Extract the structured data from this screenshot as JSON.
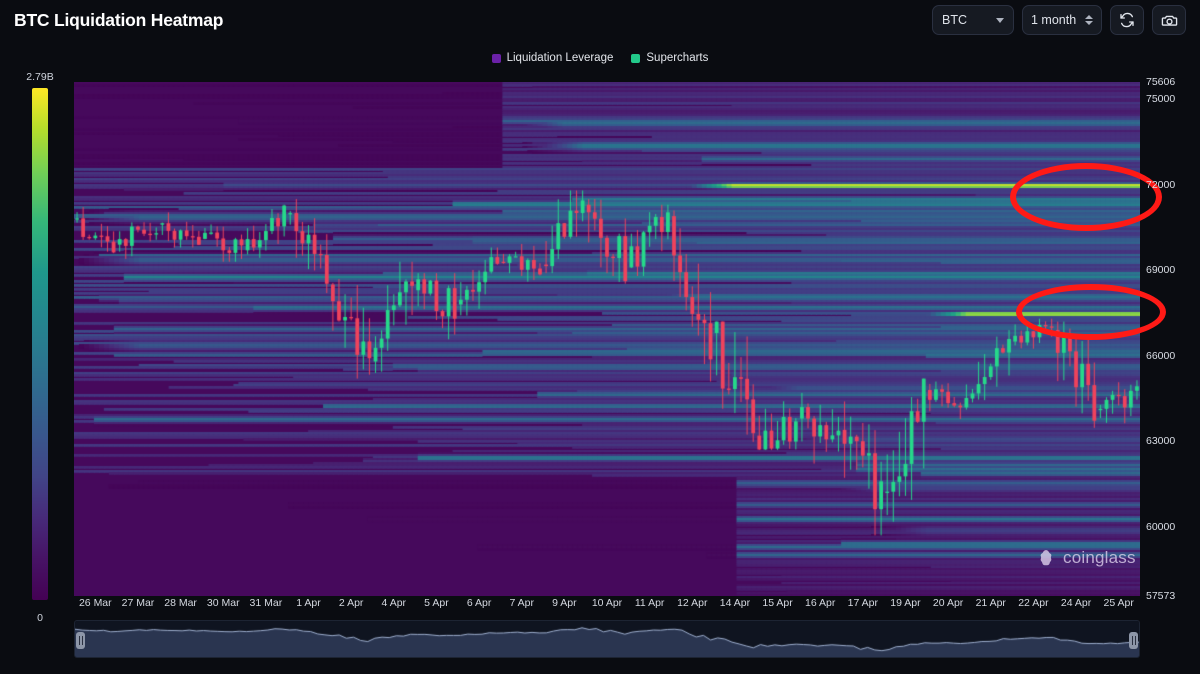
{
  "header": {
    "title": "BTC Liquidation Heatmap",
    "symbol_select": {
      "value": "BTC",
      "icon": "chevron-down-icon"
    },
    "period_stepper": {
      "value": "1 month",
      "icon": "stepper-arrows-icon"
    },
    "refresh_button": {
      "icon": "refresh-icon"
    },
    "screenshot_button": {
      "icon": "camera-icon"
    }
  },
  "legend": {
    "items": [
      {
        "label": "Liquidation Leverage",
        "color": "#6b21a8"
      },
      {
        "label": "Supercharts",
        "color": "#22c98a"
      }
    ]
  },
  "colorbar": {
    "max_label": "2.79B",
    "min_label": "0",
    "colormap": "viridis",
    "stops": [
      "#440154",
      "#414487",
      "#2a788e",
      "#22a884",
      "#7ad151",
      "#fde725"
    ]
  },
  "watermark": {
    "text": "coinglass",
    "icon": "coinglass-logo-icon"
  },
  "annotations": [
    {
      "shape": "ellipse",
      "color": "#ff1a16",
      "note": "major liquidation band near 72000"
    },
    {
      "shape": "ellipse",
      "color": "#ff1a16",
      "note": "major liquidation band near 67500"
    }
  ],
  "range_slider": {
    "left_handle": "range-handle-left",
    "right_handle": "range-handle-right"
  },
  "chart_data": {
    "type": "heatmap",
    "title": "BTC Liquidation Heatmap",
    "subtitle": "",
    "xlabel": "",
    "ylabel": "",
    "grid": false,
    "legend_position": "top-center",
    "colorbar": {
      "label": "",
      "min": 0,
      "max": 2790000000,
      "min_label": "0",
      "max_label": "2.79B"
    },
    "ylim": [
      57573,
      75606
    ],
    "y_ticks": [
      75606,
      75000,
      72000,
      69000,
      66000,
      63000,
      60000,
      57573
    ],
    "y_tick_labels": [
      "75606",
      "75000",
      "72000",
      "69000",
      "66000",
      "63000",
      "60000",
      "57573"
    ],
    "x_tick_labels": [
      "26 Mar",
      "27 Mar",
      "28 Mar",
      "30 Mar",
      "31 Mar",
      "1 Apr",
      "2 Apr",
      "4 Apr",
      "5 Apr",
      "6 Apr",
      "7 Apr",
      "9 Apr",
      "10 Apr",
      "11 Apr",
      "12 Apr",
      "14 Apr",
      "15 Apr",
      "16 Apr",
      "17 Apr",
      "19 Apr",
      "20 Apr",
      "21 Apr",
      "22 Apr",
      "24 Apr",
      "25 Apr"
    ],
    "price_series": {
      "name": "BTC price (candlesticks)",
      "up_color": "#26d98a",
      "down_color": "#f0435c",
      "candles": [
        {
          "date": "26 Mar",
          "open": 70800,
          "high": 71400,
          "low": 69600,
          "close": 69900
        },
        {
          "date": "27 Mar",
          "open": 69900,
          "high": 71200,
          "low": 69400,
          "close": 70600
        },
        {
          "date": "28 Mar",
          "open": 70600,
          "high": 71600,
          "low": 69800,
          "close": 70100
        },
        {
          "date": "30 Mar",
          "open": 70100,
          "high": 71000,
          "low": 69300,
          "close": 69700
        },
        {
          "date": "31 Mar",
          "open": 69700,
          "high": 71300,
          "low": 69200,
          "close": 71000
        },
        {
          "date": "1 Apr",
          "open": 71000,
          "high": 71500,
          "low": 68200,
          "close": 68500
        },
        {
          "date": "2 Apr",
          "open": 68500,
          "high": 69500,
          "low": 65200,
          "close": 65800
        },
        {
          "date": "4 Apr",
          "open": 65800,
          "high": 69300,
          "low": 65400,
          "close": 68300
        },
        {
          "date": "5 Apr",
          "open": 68300,
          "high": 68900,
          "low": 66200,
          "close": 67800
        },
        {
          "date": "6 Apr",
          "open": 67800,
          "high": 69800,
          "low": 67400,
          "close": 69300
        },
        {
          "date": "7 Apr",
          "open": 69300,
          "high": 70300,
          "low": 68600,
          "close": 69200
        },
        {
          "date": "9 Apr",
          "open": 69200,
          "high": 71800,
          "low": 68900,
          "close": 71300
        },
        {
          "date": "10 Apr",
          "open": 71300,
          "high": 71500,
          "low": 67400,
          "close": 69100
        },
        {
          "date": "11 Apr",
          "open": 69100,
          "high": 71300,
          "low": 68800,
          "close": 70900
        },
        {
          "date": "12 Apr",
          "open": 70900,
          "high": 71100,
          "low": 65100,
          "close": 66800
        },
        {
          "date": "14 Apr",
          "open": 66800,
          "high": 67200,
          "low": 61800,
          "close": 63200
        },
        {
          "date": "15 Apr",
          "open": 63200,
          "high": 66500,
          "low": 62700,
          "close": 63800
        },
        {
          "date": "16 Apr",
          "open": 63800,
          "high": 64800,
          "low": 61500,
          "close": 63400
        },
        {
          "date": "17 Apr",
          "open": 63400,
          "high": 64400,
          "low": 59700,
          "close": 61200
        },
        {
          "date": "19 Apr",
          "open": 61200,
          "high": 65200,
          "low": 59600,
          "close": 64800
        },
        {
          "date": "20 Apr",
          "open": 64800,
          "high": 65500,
          "low": 63700,
          "close": 64500
        },
        {
          "date": "21 Apr",
          "open": 64500,
          "high": 66900,
          "low": 64200,
          "close": 66500
        },
        {
          "date": "22 Apr",
          "open": 66500,
          "high": 67300,
          "low": 65800,
          "close": 66900
        },
        {
          "date": "24 Apr",
          "open": 66900,
          "high": 67200,
          "low": 63200,
          "close": 64100
        },
        {
          "date": "25 Apr",
          "open": 64100,
          "high": 65400,
          "low": 63500,
          "close": 64700
        }
      ]
    },
    "liquidation_bands": [
      {
        "price": 72000,
        "intensity": 1.0,
        "start_frac": 0.56,
        "end_frac": 1.0,
        "label": "highest leverage cluster"
      },
      {
        "price": 67500,
        "intensity": 0.97,
        "start_frac": 0.78,
        "end_frac": 1.0,
        "label": "second cluster"
      },
      {
        "price": 74200,
        "intensity": 0.45,
        "start_frac": 0.4,
        "end_frac": 1.0
      },
      {
        "price": 73400,
        "intensity": 0.5,
        "start_frac": 0.42,
        "end_frac": 1.0
      },
      {
        "price": 70900,
        "intensity": 0.42,
        "start_frac": 0.0,
        "end_frac": 1.0
      },
      {
        "price": 69400,
        "intensity": 0.4,
        "start_frac": 0.0,
        "end_frac": 1.0
      },
      {
        "price": 68100,
        "intensity": 0.47,
        "start_frac": 0.52,
        "end_frac": 1.0
      },
      {
        "price": 66400,
        "intensity": 0.38,
        "start_frac": 0.0,
        "end_frac": 1.0
      },
      {
        "price": 64900,
        "intensity": 0.36,
        "start_frac": 0.62,
        "end_frac": 1.0
      },
      {
        "price": 63100,
        "intensity": 0.33,
        "start_frac": 0.66,
        "end_frac": 1.0
      },
      {
        "price": 61400,
        "intensity": 0.3,
        "start_frac": 0.7,
        "end_frac": 1.0
      },
      {
        "price": 59900,
        "intensity": 0.28,
        "start_frac": 0.74,
        "end_frac": 1.0
      }
    ]
  }
}
